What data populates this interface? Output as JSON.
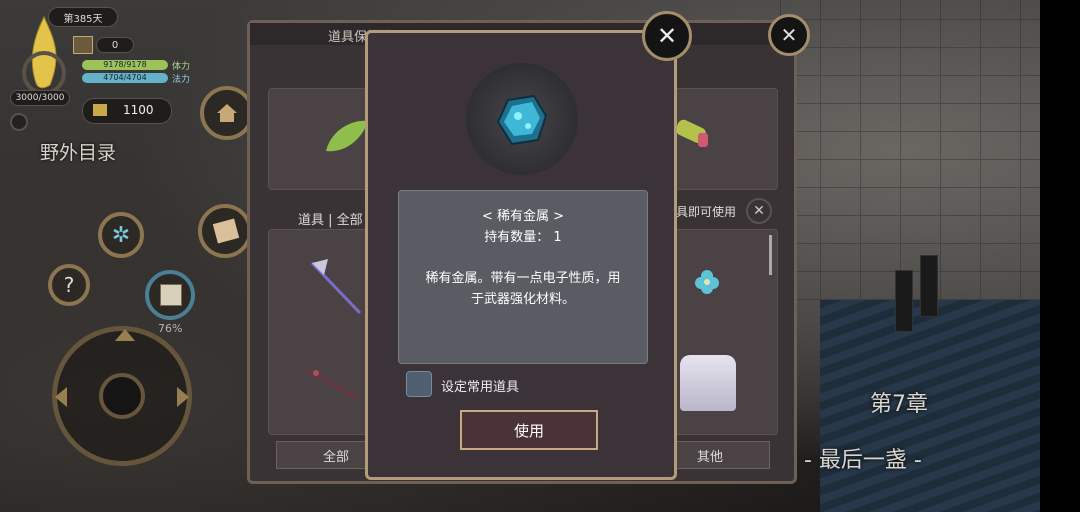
{
  "hud": {
    "day": "第385天",
    "box_count": "0",
    "hp": "9178/9178",
    "hp_label": "体力",
    "mp": "4704/4704",
    "mp_label": "法力",
    "soul": "3000/3000",
    "gold": "1100",
    "area_name": "野外目录",
    "progress": "76%"
  },
  "backpanel": {
    "title": "道具保管箱",
    "filter_label": "道具 | 全部",
    "use_hint": "具即可使用",
    "tab_all": "全部",
    "tab_other": "其他"
  },
  "item_dialog": {
    "name": "< 稀有金属 >",
    "count": "持有数量： 1",
    "desc_line1": "稀有金属。带有一点电子性质，用",
    "desc_line2": "于武器强化材料。",
    "favorite_label": "设定常用道具",
    "use_button": "使用"
  },
  "chapter": {
    "number": "第7章",
    "title": "- 最后一盏 -"
  },
  "colors": {
    "accent_gold": "#b39c7a",
    "hp_bar": "#9cc25a",
    "mp_bar": "#64b3c8",
    "gem": "#3fb8d8"
  }
}
